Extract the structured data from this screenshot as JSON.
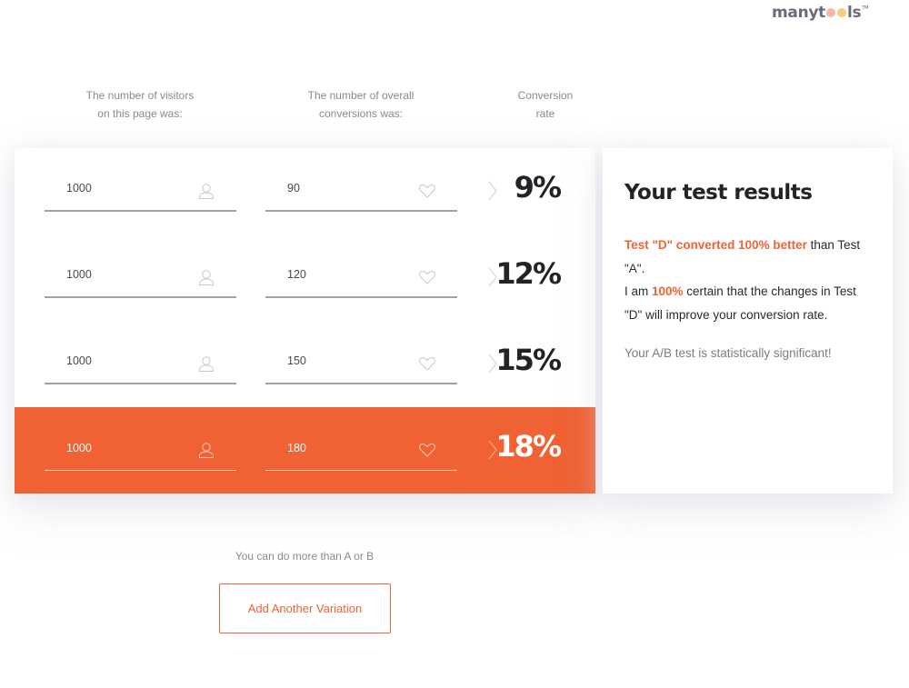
{
  "brand": {
    "logo_text_start": "many",
    "logo_text_t": "t",
    "logo_text_end": "ls",
    "logo_tm": "TM",
    "logo_dot_colors": [
      "#f7b6a8",
      "#f6cf7a"
    ],
    "text_color": "#6b6a7a"
  },
  "columns": {
    "visitors_line1": "The number of visitors",
    "visitors_line2": "on this page was:",
    "conversions_line1": "The number of overall",
    "conversions_line2": "conversions was:",
    "rate_line1": "Conversion",
    "rate_line2": "rate"
  },
  "variations": [
    {
      "visitors": "1000",
      "conversions": "90",
      "rate": "9%",
      "highlighted": false
    },
    {
      "visitors": "1000",
      "conversions": "120",
      "rate": "12%",
      "highlighted": false
    },
    {
      "visitors": "1000",
      "conversions": "150",
      "rate": "15%",
      "highlighted": false
    },
    {
      "visitors": "1000",
      "conversions": "180",
      "rate": "18%",
      "highlighted": true
    }
  ],
  "icons": {
    "visitors": "user-icon",
    "conversions": "heart-icon",
    "separator": "chevron-right-icon"
  },
  "results": {
    "title": "Your test results",
    "winner_phrase": "Test \"D\" converted 100% better",
    "compare_phrase": " than Test \"A\".",
    "certainty_prefix": "I am ",
    "certainty_value": "100%",
    "certainty_suffix": " certain that the changes in Test \"D\" will improve your conversion rate.",
    "significance": "Your A/B test is statistically significant!"
  },
  "footer": {
    "more_text": "You can do more than A or B",
    "add_button": "Add Another Variation"
  },
  "colors": {
    "accent": "#f06234",
    "text_dark": "#222326",
    "text_muted": "#8a8a8f"
  }
}
